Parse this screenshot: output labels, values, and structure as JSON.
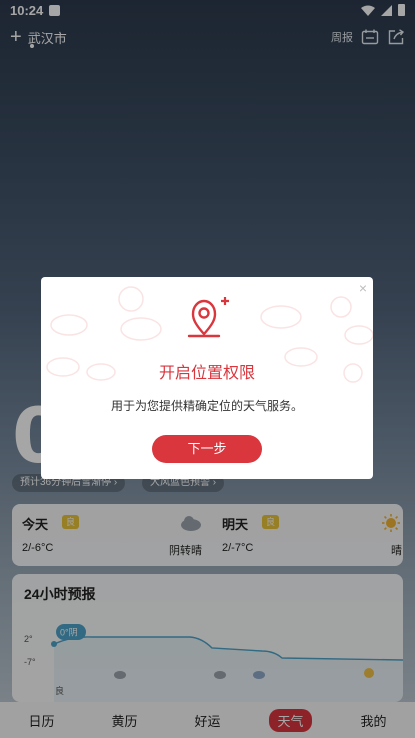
{
  "status_bar": {
    "time": "10:24"
  },
  "topbar": {
    "city": "武汉市",
    "week_label": "周报"
  },
  "current": {
    "temp": "0",
    "tip1": "预计36分钟后雪渐停 ›",
    "tip2": "大风蓝色预警 ›"
  },
  "forecast": {
    "today": {
      "name": "今天",
      "aqi": "良",
      "range": "2/-6°C",
      "condition": "阴转晴"
    },
    "tomorrow": {
      "name": "明天",
      "aqi": "良",
      "range": "2/-7°C",
      "condition": "晴"
    }
  },
  "hourly": {
    "title": "24小时预报",
    "high_label": "2°",
    "low_label": "-7°",
    "current_tag": "0°阴",
    "quality": "良"
  },
  "nav": [
    "日历",
    "黄历",
    "好运",
    "天气",
    "我的"
  ],
  "dialog": {
    "title": "开启位置权限",
    "message": "用于为您提供精确定位的天气服务。",
    "button": "下一步"
  },
  "colors": {
    "accent": "#d9363e",
    "aqi": "#e9c43a",
    "line": "#4ea3c9"
  }
}
